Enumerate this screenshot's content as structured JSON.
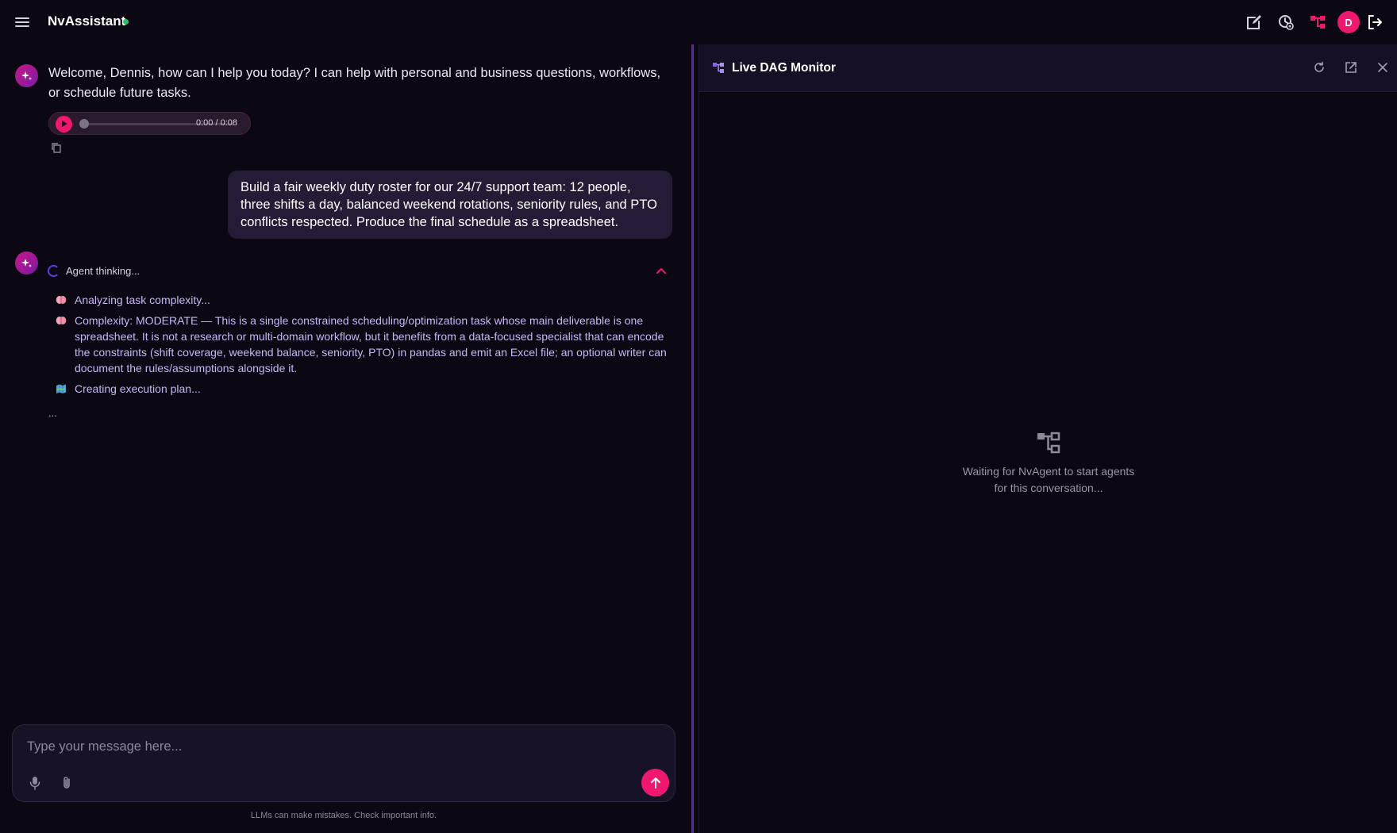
{
  "header": {
    "app_title": "NvAssistant",
    "status_color": "#22c55e",
    "avatar_initial": "D",
    "accent_color": "#f0186e"
  },
  "chat": {
    "welcome_message": "Welcome, Dennis, how can I help you today? I can help with personal and business questions, workflows, or schedule future tasks.",
    "audio": {
      "time": "0:00 / 0:08",
      "progress": 0
    },
    "user_message": "Build a fair weekly duty roster for our 24/7 support team: 12 people, three shifts a day, balanced weekend rotations, seniority rules, and PTO conflicts respected. Produce the final schedule as a spreadsheet.",
    "thinking": {
      "label": "Agent thinking...",
      "steps": [
        {
          "icon": "brain-icon",
          "text": "Analyzing task complexity..."
        },
        {
          "icon": "brain-icon",
          "text": "Complexity: MODERATE — This is a single constrained scheduling/optimization task whose main deliverable is one spreadsheet. It is not a research or multi-domain workflow, but it benefits from a data-focused specialist that can encode the constraints (shift coverage, weekend balance, seniority, PTO) in pandas and emit an Excel file; an optional writer can document the rules/assumptions alongside it."
        },
        {
          "icon": "map-icon",
          "text": "Creating execution plan..."
        }
      ],
      "trailing": "..."
    },
    "composer": {
      "placeholder": "Type your message here...",
      "value": ""
    },
    "disclaimer": "LLMs can make mistakes. Check important info."
  },
  "dag_monitor": {
    "title": "Live DAG Monitor",
    "empty_line_1": "Waiting for NvAgent to start agents",
    "empty_line_2": "for this conversation..."
  }
}
